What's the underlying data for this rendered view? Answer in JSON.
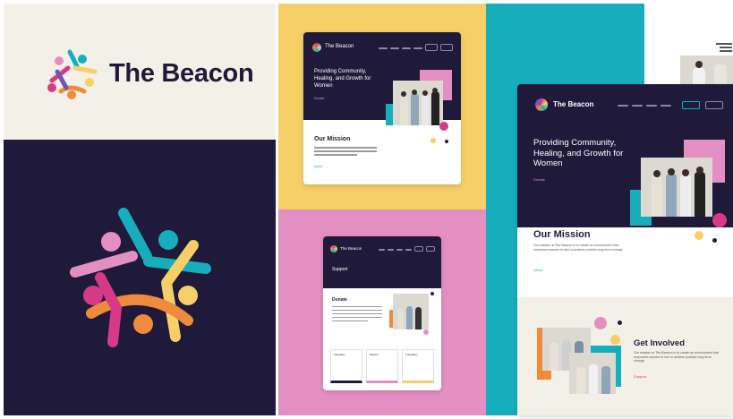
{
  "brand": {
    "name": "The Beacon"
  },
  "colors": {
    "navy": "#1f1a3a",
    "cream": "#f3f0e7",
    "yellow": "#f6cf66",
    "pink": "#e48fc1",
    "teal": "#16aebc",
    "magenta": "#d63a86",
    "orange": "#f08a3c",
    "purple": "#7a4fb5"
  },
  "hero": {
    "heading": "Providing Community, Healing, and Growth for Women",
    "cta": "Donate"
  },
  "mission": {
    "heading": "Our Mission",
    "body": "Our mission at The Beacon is to create an environment that empowers women to rise to achieve positive long-term change.",
    "link": "About"
  },
  "support_page": {
    "title": "Support",
    "section": "Donate",
    "cards": [
      "Volunteer",
      "Partner",
      "Fundraise"
    ]
  },
  "involved": {
    "heading": "Get Involved",
    "body": "Our mission at The Beacon is to create an environment that empowers women to rise to achieve positive long-term change.",
    "cta": "Support"
  }
}
